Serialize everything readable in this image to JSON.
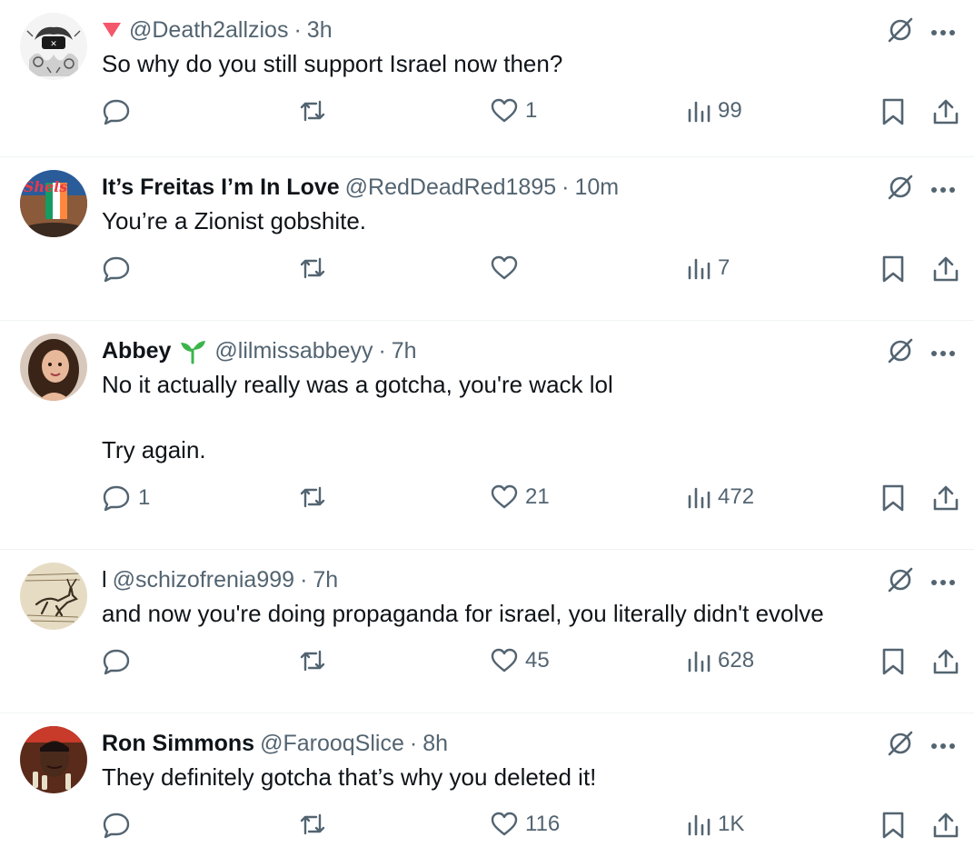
{
  "tweets": [
    {
      "display_name": "",
      "handle": "@Death2allzios",
      "time": "3h",
      "badge_icon": "red-triangle-icon",
      "text": "So why do you still support Israel now then?",
      "replies": "",
      "likes": "1",
      "views": "99"
    },
    {
      "display_name": "It’s Freitas I’m In Love",
      "handle": "@RedDeadRed1895",
      "time": "10m",
      "text": "You’re a Zionist gobshite.",
      "replies": "",
      "likes": "",
      "views": "7"
    },
    {
      "display_name": "Abbey",
      "handle": "@lilmissabbeyy",
      "time": "7h",
      "badge_icon": "seedling-icon",
      "text": "No it actually really was a gotcha, you're wack lol\n\nTry again.",
      "replies": "1",
      "likes": "21",
      "views": "472"
    },
    {
      "display_name": "l",
      "handle": "@schizofrenia999",
      "time": "7h",
      "text": "and now you're doing propaganda for israel, you literally didn't evolve",
      "replies": "",
      "likes": "45",
      "views": "628"
    },
    {
      "display_name": "Ron Simmons",
      "handle": "@FarooqSlice",
      "time": "8h",
      "text": "They definitely gotcha that’s why you deleted it!",
      "replies": "",
      "likes": "116",
      "views": "1K"
    }
  ],
  "icons": {
    "reply": "reply-icon",
    "retweet": "retweet-icon",
    "like": "like-icon",
    "views": "views-icon",
    "bookmark": "bookmark-icon",
    "share": "share-icon",
    "grok": "grok-icon",
    "more": "more-icon"
  },
  "colors": {
    "text": "#0f1419",
    "secondary": "#536471",
    "divider": "#eff3f4",
    "badge_red": "#f4576b",
    "badge_green": "#3bb54a"
  }
}
